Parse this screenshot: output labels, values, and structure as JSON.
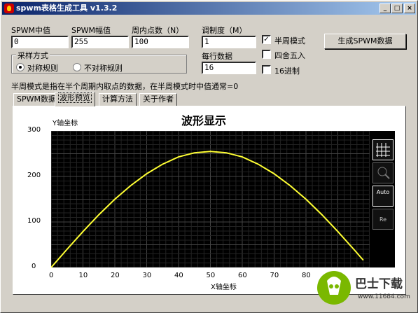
{
  "window": {
    "title": "spwm表格生成工具 v1.3.2",
    "min": "_",
    "max": "□",
    "close": "×"
  },
  "fields": {
    "center_label": "SPWM中值",
    "center_value": "0",
    "amplitude_label": "SPWM幅值",
    "amplitude_value": "255",
    "points_label": "周内点数（N）",
    "points_value": "100",
    "modulation_label": "调制度（M）",
    "modulation_value": "1",
    "per_row_label": "每行数据",
    "per_row_value": "16"
  },
  "options": {
    "half_period": {
      "label": "半周模式",
      "checked": true
    },
    "rounding": {
      "label": "四舍五入",
      "checked": false
    },
    "hex": {
      "label": "16进制",
      "checked": false
    }
  },
  "sampling": {
    "group_label": "采样方式",
    "symmetric": {
      "label": "对称规则",
      "selected": true
    },
    "asymmetric": {
      "label": "不对称规则",
      "selected": false
    }
  },
  "generate_button": "生成SPWM数据",
  "hint": "半周模式是指在半个周期内取点的数据，在半周模式时中值通常=0",
  "tabs": [
    {
      "label": "SPWM数据",
      "active": false
    },
    {
      "label": "波形预览",
      "active": true
    },
    {
      "label": "计算方法",
      "active": false
    },
    {
      "label": "关于作者",
      "active": false
    }
  ],
  "chart_data": {
    "type": "line",
    "title": "波形显示",
    "xlabel": "X轴坐标",
    "ylabel": "Y轴坐标",
    "xlim": [
      0,
      100
    ],
    "ylim": [
      0,
      300
    ],
    "x_ticks": [
      "0",
      "10",
      "20",
      "30",
      "40",
      "50",
      "60",
      "70",
      "80",
      "90"
    ],
    "y_ticks": [
      "0",
      "100",
      "200",
      "300"
    ],
    "series": [
      {
        "x": [
          0,
          5,
          10,
          15,
          20,
          25,
          30,
          35,
          40,
          45,
          50,
          55,
          60,
          65,
          70,
          75,
          80,
          85,
          90,
          95,
          98
        ],
        "y": [
          0,
          40,
          79,
          116,
          150,
          180,
          206,
          227,
          243,
          252,
          255,
          252,
          243,
          227,
          206,
          180,
          150,
          116,
          79,
          40,
          16
        ]
      }
    ],
    "line_color": "#ffff33",
    "background": "#000000",
    "grid": true
  },
  "tools": {
    "grid_icon": "grid-icon",
    "zoom_icon": "zoom-icon",
    "auto_label": "Auto",
    "reset_label": "Re"
  },
  "watermark": {
    "brand": "巴士下载",
    "url": "www.11684.com"
  }
}
